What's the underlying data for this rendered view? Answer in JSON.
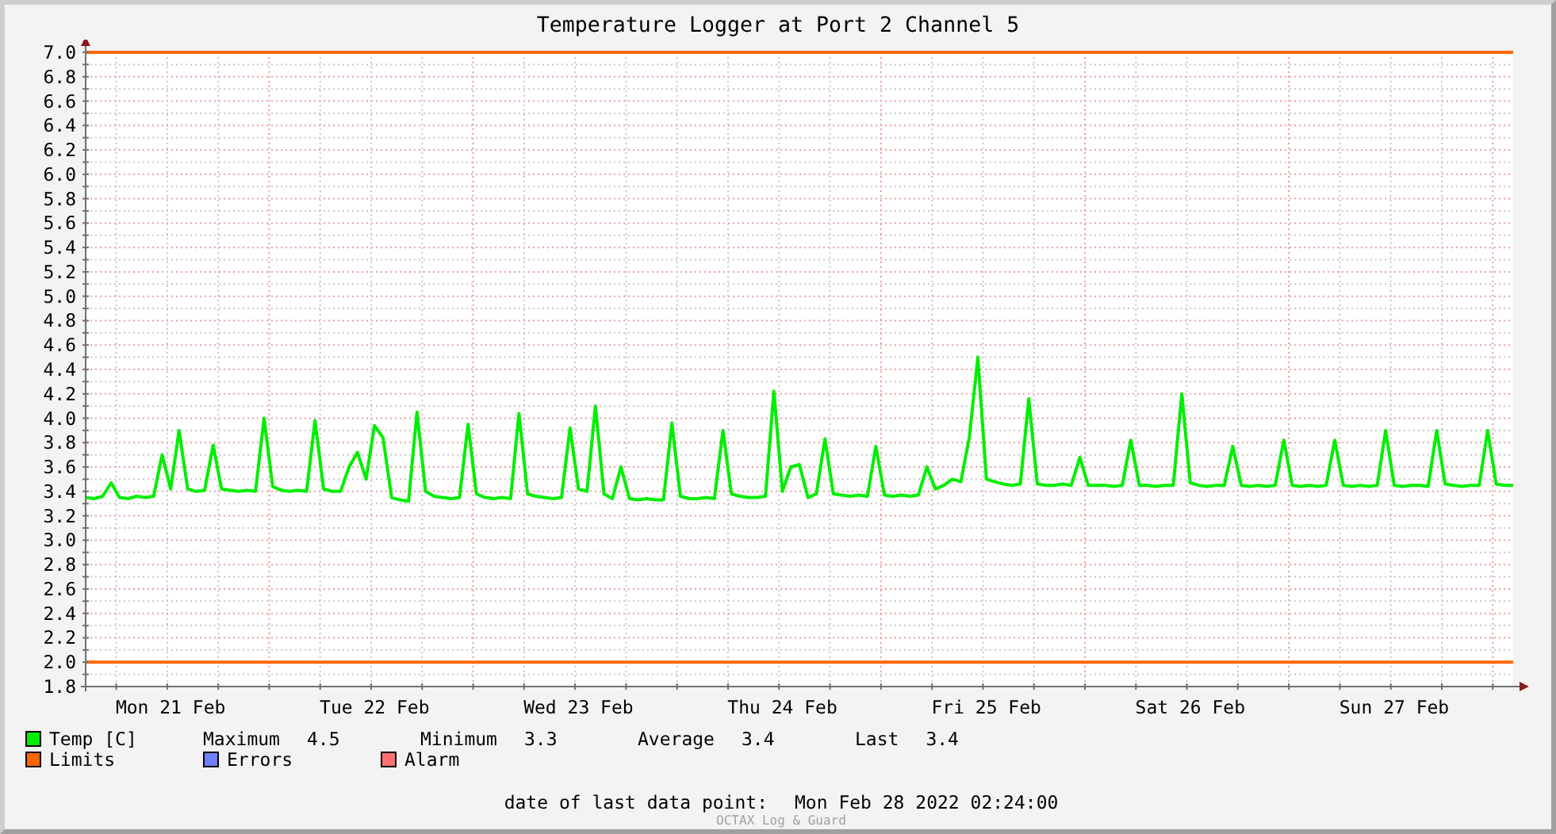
{
  "title": "Temperature Logger at Port 2 Channel 5",
  "chart": {
    "chart_data": {
      "type": "line",
      "ylim": [
        1.8,
        7.0
      ],
      "grid": true,
      "yticks": [
        {
          "value": 1.8,
          "label": "1.8"
        },
        {
          "value": 2.0,
          "label": "2.0"
        },
        {
          "value": 2.2,
          "label": "2.2"
        },
        {
          "value": 2.4,
          "label": "2.4"
        },
        {
          "value": 2.6,
          "label": "2.6"
        },
        {
          "value": 2.8,
          "label": "2.8"
        },
        {
          "value": 3.0,
          "label": "3.0"
        },
        {
          "value": 3.2,
          "label": "3.2"
        },
        {
          "value": 3.4,
          "label": "3.4"
        },
        {
          "value": 3.6,
          "label": "3.6"
        },
        {
          "value": 3.8,
          "label": "3.8"
        },
        {
          "value": 4.0,
          "label": "4.0"
        },
        {
          "value": 4.2,
          "label": "4.2"
        },
        {
          "value": 4.4,
          "label": "4.4"
        },
        {
          "value": 4.6,
          "label": "4.6"
        },
        {
          "value": 4.8,
          "label": "4.8"
        },
        {
          "value": 5.0,
          "label": "5.0"
        },
        {
          "value": 5.2,
          "label": "5.2"
        },
        {
          "value": 5.4,
          "label": "5.4"
        },
        {
          "value": 5.6,
          "label": "5.6"
        },
        {
          "value": 5.8,
          "label": "5.8"
        },
        {
          "value": 6.0,
          "label": "6.0"
        },
        {
          "value": 6.2,
          "label": "6.2"
        },
        {
          "value": 6.4,
          "label": "6.4"
        },
        {
          "value": 6.6,
          "label": "6.6"
        },
        {
          "value": 6.8,
          "label": "6.8"
        },
        {
          "value": 7.0,
          "label": "7.0"
        }
      ],
      "categories": [
        null,
        null,
        null,
        null,
        null,
        null,
        null,
        null,
        null,
        null,
        "Mon 21 Feb",
        null,
        null,
        null,
        null,
        null,
        null,
        null,
        null,
        null,
        null,
        null,
        null,
        null,
        null,
        null,
        null,
        null,
        null,
        null,
        null,
        null,
        null,
        null,
        "Tue 22 Feb",
        null,
        null,
        null,
        null,
        null,
        null,
        null,
        null,
        null,
        null,
        null,
        null,
        null,
        null,
        null,
        null,
        null,
        null,
        null,
        null,
        null,
        null,
        null,
        "Wed 23 Feb",
        null,
        null,
        null,
        null,
        null,
        null,
        null,
        null,
        null,
        null,
        null,
        null,
        null,
        null,
        null,
        null,
        null,
        null,
        null,
        null,
        null,
        null,
        null,
        "Thu 24 Feb",
        null,
        null,
        null,
        null,
        null,
        null,
        null,
        null,
        null,
        null,
        null,
        null,
        null,
        null,
        null,
        null,
        null,
        null,
        null,
        null,
        null,
        null,
        null,
        "Fri 25 Feb",
        null,
        null,
        null,
        null,
        null,
        null,
        null,
        null,
        null,
        null,
        null,
        null,
        null,
        null,
        null,
        null,
        null,
        null,
        null,
        null,
        null,
        null,
        null,
        "Sat 26 Feb",
        null,
        null,
        null,
        null,
        null,
        null,
        null,
        null,
        null,
        null,
        null,
        null,
        null,
        null,
        null,
        null,
        null,
        null,
        null,
        null,
        null,
        null,
        null,
        "Sun 27 Feb",
        null,
        null,
        null,
        null,
        null,
        null,
        null,
        null,
        null,
        null,
        null,
        null,
        null,
        null
      ],
      "series": [
        {
          "name": "Temp [C]",
          "color": "#00ee00",
          "values": [
            3.35,
            3.34,
            3.36,
            3.47,
            3.35,
            3.34,
            3.36,
            3.35,
            3.36,
            3.7,
            3.42,
            3.9,
            3.42,
            3.4,
            3.41,
            3.78,
            3.42,
            3.41,
            3.4,
            3.41,
            3.4,
            4.0,
            3.44,
            3.41,
            3.4,
            3.41,
            3.4,
            3.98,
            3.42,
            3.4,
            3.4,
            3.6,
            3.72,
            3.5,
            3.94,
            3.84,
            3.35,
            3.33,
            3.32,
            4.05,
            3.4,
            3.36,
            3.35,
            3.34,
            3.35,
            3.95,
            3.38,
            3.35,
            3.34,
            3.35,
            3.34,
            4.04,
            3.38,
            3.36,
            3.35,
            3.34,
            3.35,
            3.92,
            3.42,
            3.4,
            4.1,
            3.38,
            3.34,
            3.6,
            3.34,
            3.33,
            3.34,
            3.33,
            3.33,
            3.96,
            3.36,
            3.34,
            3.34,
            3.35,
            3.34,
            3.9,
            3.38,
            3.36,
            3.35,
            3.35,
            3.36,
            4.22,
            3.4,
            3.6,
            3.62,
            3.35,
            3.38,
            3.83,
            3.38,
            3.37,
            3.36,
            3.37,
            3.36,
            3.77,
            3.37,
            3.36,
            3.37,
            3.36,
            3.37,
            3.6,
            3.42,
            3.45,
            3.5,
            3.48,
            3.84,
            4.5,
            3.5,
            3.48,
            3.46,
            3.45,
            3.46,
            4.16,
            3.46,
            3.45,
            3.45,
            3.46,
            3.45,
            3.68,
            3.45,
            3.45,
            3.45,
            3.44,
            3.45,
            3.82,
            3.45,
            3.45,
            3.44,
            3.45,
            3.45,
            4.2,
            3.47,
            3.45,
            3.44,
            3.45,
            3.45,
            3.77,
            3.45,
            3.44,
            3.45,
            3.44,
            3.45,
            3.82,
            3.45,
            3.44,
            3.45,
            3.44,
            3.45,
            3.82,
            3.45,
            3.44,
            3.45,
            3.44,
            3.45,
            3.9,
            3.45,
            3.44,
            3.45,
            3.45,
            3.44,
            3.9,
            3.46,
            3.45,
            3.44,
            3.45,
            3.45,
            3.9,
            3.46,
            3.45,
            3.45
          ]
        }
      ],
      "ref_lines": [
        {
          "axis": "y",
          "value": 7.0
        },
        {
          "axis": "y",
          "value": 2.0
        }
      ]
    }
  },
  "legend": [
    {
      "label": "Limits",
      "color": "#ff6600"
    },
    {
      "label": "Errors",
      "color": "#6f7fff"
    },
    {
      "label": "Alarm",
      "color": "#ff7070"
    }
  ],
  "stats": [
    {
      "label": "Maximum",
      "value": "4.5"
    },
    {
      "label": "Minimum",
      "value": "3.3"
    },
    {
      "label": "Average",
      "value": "3.4"
    },
    {
      "label": "Last",
      "value": "3.4"
    }
  ],
  "last_data_point": {
    "label": "date of last data point:",
    "value": "Mon Feb 28 2022 02:24:00"
  },
  "footer": "OCTAX Log & Guard"
}
